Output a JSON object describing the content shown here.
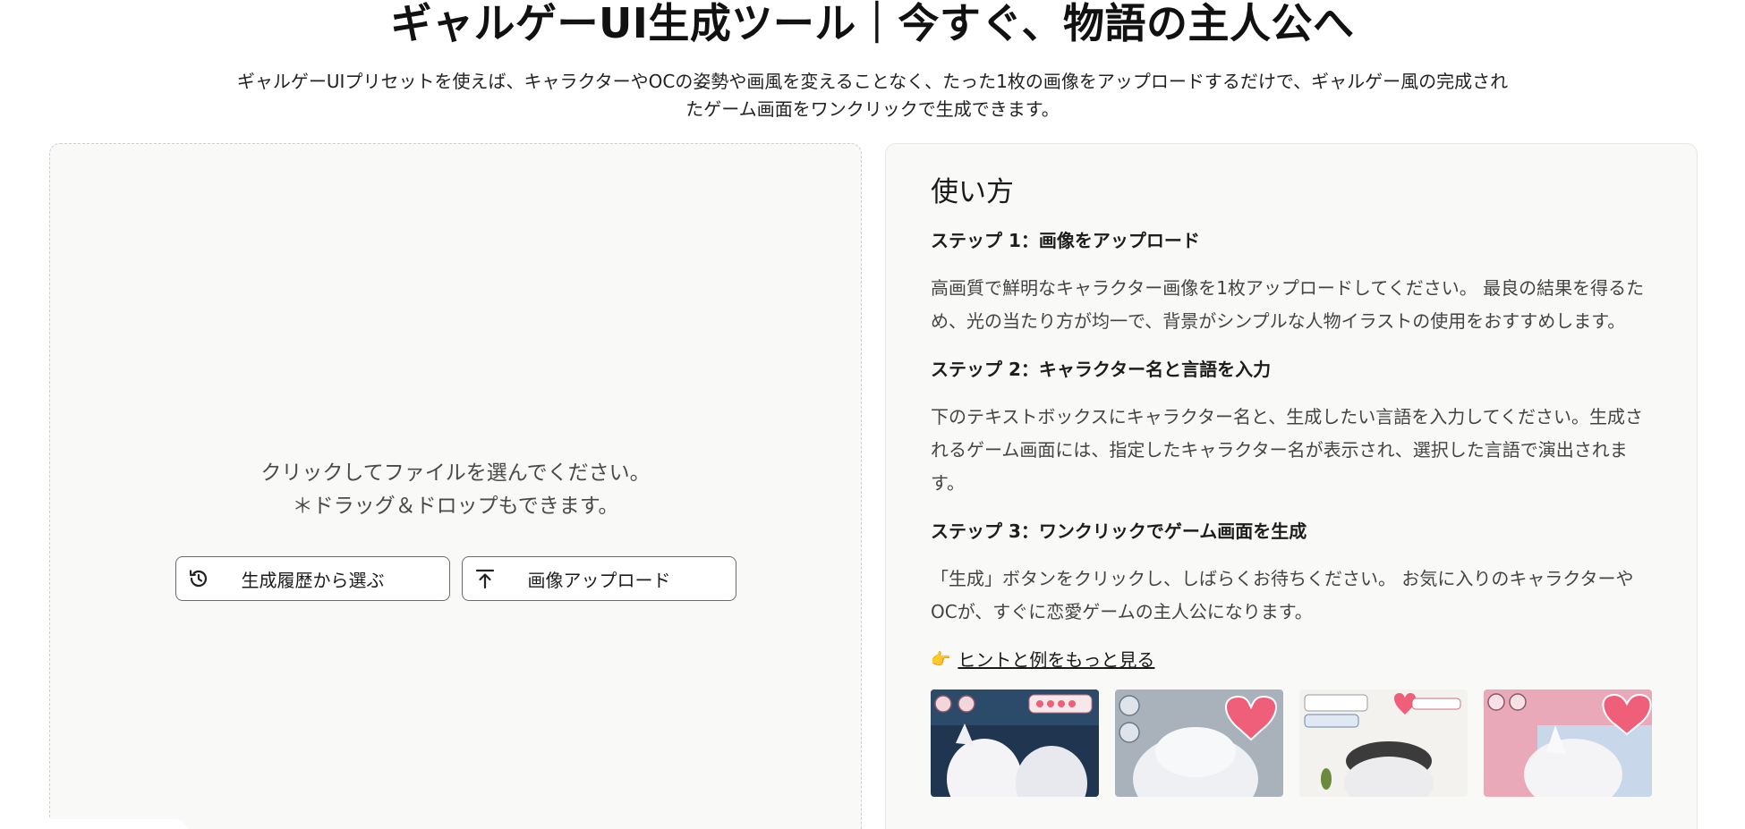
{
  "header": {
    "title": "ギャルゲーUI生成ツール｜今すぐ、物語の主人公へ",
    "subtitle_line1": "ギャルゲーUIプリセットを使えば、キャラクターやOCの姿勢や画風を変えることなく、たった1枚の画像をアップロードするだけで、ギャルゲー風の完成され",
    "subtitle_line2": "たゲーム画面をワンクリックで生成できます。"
  },
  "upload": {
    "hint_line1": "クリックしてファイルを選んでください。",
    "hint_line2": "＊ドラッグ＆ドロップもできます。",
    "history_button": "生成履歴から選ぶ",
    "upload_button": "画像アップロード",
    "history_icon": "history-icon",
    "upload_icon": "upload-arrow-icon"
  },
  "howto": {
    "title": "使い方",
    "steps": [
      {
        "heading": "ステップ 1：画像をアップロード",
        "body": "高画質で鮮明なキャラクター画像を1枚アップロードしてください。 最良の結果を得るため、光の当たり方が均一で、背景がシンプルな人物イラストの使用をおすすめします。"
      },
      {
        "heading": "ステップ 2：キャラクター名と言語を入力",
        "body": "下のテキストボックスにキャラクター名と、生成したい言語を入力してください。生成されるゲーム画面には、指定したキャラクター名が表示され、選択した言語で演出されます。"
      },
      {
        "heading": "ステップ 3：ワンクリックでゲーム画面を生成",
        "body": "「生成」ボタンをクリックし、しばらくお待ちください。 お気に入りのキャラクターやOCが、すぐに恋愛ゲームの主人公になります。"
      }
    ],
    "tip_icon": "pointing-hand-icon",
    "tip_emoji": "👉",
    "tip_link": "ヒントと例をもっと見る"
  },
  "colors": {
    "panel_bg": "#f9f9f8",
    "heart": "#ef5f7a",
    "text": "#1f1f1f"
  }
}
